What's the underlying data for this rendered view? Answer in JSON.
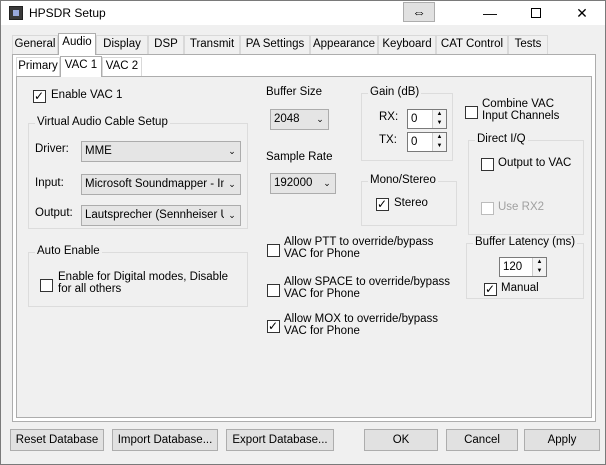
{
  "window": {
    "title": "HPSDR Setup",
    "special_button_glyph": "⇔",
    "minimize_glyph": "—",
    "close_glyph": "✕"
  },
  "tabs": [
    {
      "label": "General"
    },
    {
      "label": "Audio"
    },
    {
      "label": "Display"
    },
    {
      "label": "DSP"
    },
    {
      "label": "Transmit"
    },
    {
      "label": "PA Settings"
    },
    {
      "label": "Appearance"
    },
    {
      "label": "Keyboard"
    },
    {
      "label": "CAT Control"
    },
    {
      "label": "Tests"
    }
  ],
  "active_tab": "Audio",
  "subtabs": [
    {
      "label": "Primary"
    },
    {
      "label": "VAC 1"
    },
    {
      "label": "VAC 2"
    }
  ],
  "active_subtab": "VAC 1",
  "enable_vac": {
    "label": "Enable VAC 1",
    "checked": true
  },
  "vac_setup": {
    "title": "Virtual Audio Cable Setup",
    "driver_label": "Driver:",
    "driver_value": "MME",
    "input_label": "Input:",
    "input_value": "Microsoft Soundmapper - Inp",
    "output_label": "Output:",
    "output_value": "Lautsprecher (Sennheiser US"
  },
  "auto_enable": {
    "title": "Auto Enable",
    "option_line1": "Enable for Digital modes, Disable",
    "option_line2": "for all others",
    "checked": false
  },
  "buffer_size": {
    "title": "Buffer Size",
    "value": "2048"
  },
  "sample_rate": {
    "title": "Sample Rate",
    "value": "192000"
  },
  "gain": {
    "title": "Gain (dB)",
    "rx_label": "RX:",
    "rx_value": "0",
    "tx_label": "TX:",
    "tx_value": "0"
  },
  "mono_stereo": {
    "title": "Mono/Stereo",
    "stereo_label": "Stereo",
    "stereo_checked": true
  },
  "override": [
    {
      "line1": "Allow PTT to override/bypass",
      "line2": "VAC for Phone",
      "checked": false
    },
    {
      "line1": "Allow SPACE to override/bypass",
      "line2": "VAC for Phone",
      "checked": false
    },
    {
      "line1": "Allow MOX to override/bypass",
      "line2": "VAC for Phone",
      "checked": true
    }
  ],
  "combine_vac": {
    "line1": "Combine VAC",
    "line2": "Input Channels",
    "checked": false
  },
  "direct_iq": {
    "title": "Direct I/Q",
    "output_label": "Output to VAC",
    "output_checked": false,
    "use_rx2_label": "Use RX2",
    "use_rx2_checked": false
  },
  "buffer_latency": {
    "title": "Buffer Latency (ms)",
    "value": "120",
    "manual_label": "Manual",
    "manual_checked": true
  },
  "buttons": {
    "reset": "Reset Database",
    "import": "Import Database...",
    "export": "Export Database...",
    "ok": "OK",
    "cancel": "Cancel",
    "apply": "Apply"
  }
}
